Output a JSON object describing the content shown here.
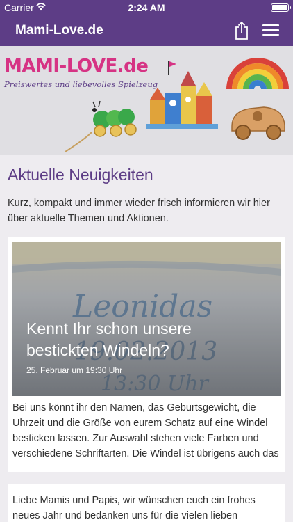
{
  "status_bar": {
    "carrier": "Carrier",
    "time": "2:24 AM"
  },
  "nav": {
    "title": "Mami-Love.de",
    "share_icon": "share-icon",
    "menu_icon": "hamburger-menu-icon"
  },
  "banner": {
    "logo_text": "MAMI-LOVE.de",
    "tagline": "Preiswertes und liebevolles Spielzeug"
  },
  "content": {
    "section_title": "Aktuelle Neuigkeiten",
    "intro": "Kurz, kompakt und immer wieder frisch informieren wir hier über aktuelle Themen und Aktionen.",
    "posts": [
      {
        "title": "Kennt Ihr schon unsere bestickten Windeln?",
        "date": "25. Februar um 19:30 Uhr",
        "image_embroidery": "Leonidas",
        "image_embroidery_date": "19.02.2013",
        "image_embroidery_time": "13:30 Uhr",
        "excerpt": "Bei uns könnt ihr den Namen, das Geburtsgewicht, die Uhrzeit und die Größe von eurem Schatz auf eine Windel besticken lassen. Zur Auswahl stehen viele Farben und verschiedene Schriftarten. Die Windel ist übrigens auch das"
      },
      {
        "excerpt": "Liebe Mamis und Papis, wir wünschen euch ein frohes neues Jahr und bedanken uns für die vielen lieben"
      }
    ]
  },
  "colors": {
    "brand_purple": "#5d3d86",
    "logo_pink": "#d63384",
    "background": "#eeecf0"
  }
}
